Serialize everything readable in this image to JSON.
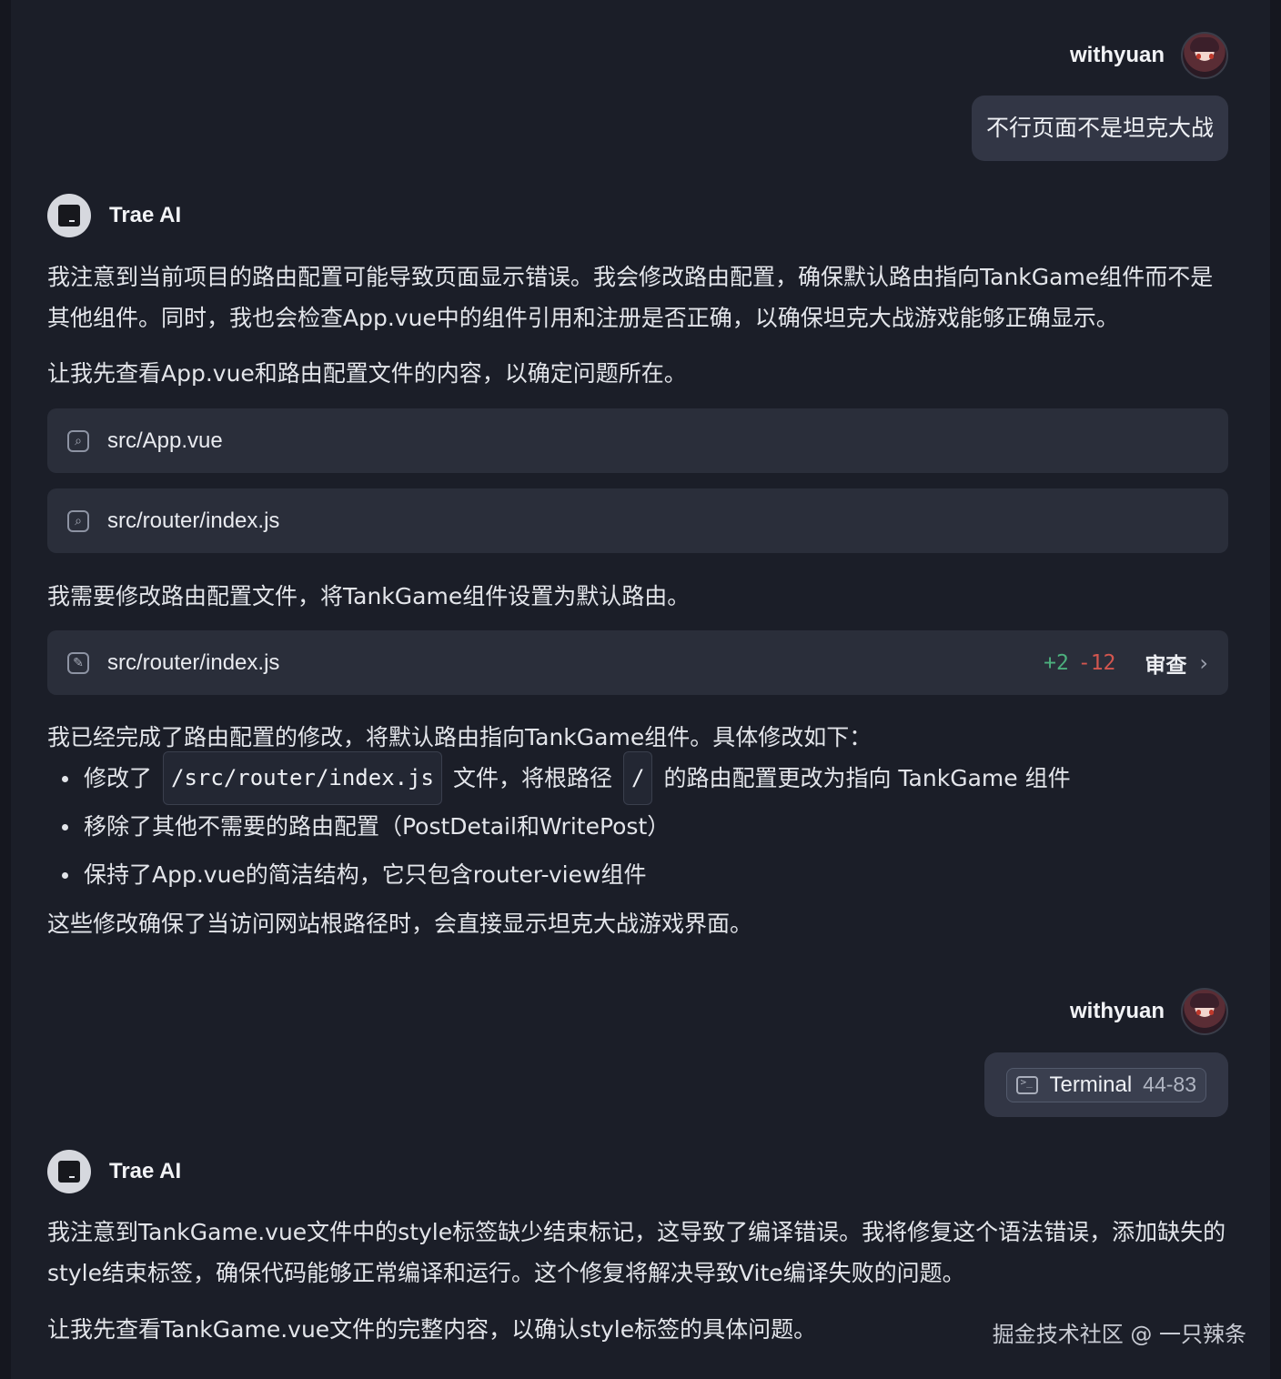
{
  "messages": {
    "user1": {
      "name": "withyuan",
      "text": "不行页面不是坦克大战"
    },
    "ai1": {
      "name": "Trae AI",
      "p1": "我注意到当前项目的路由配置可能导致页面显示错误。我会修改路由配置，确保默认路由指向TankGame组件而不是其他组件。同时，我也会检查App.vue中的组件引用和注册是否正确，以确保坦克大战游戏能够正确显示。",
      "p2": "让我先查看App.vue和路由配置文件的内容，以确定问题所在。",
      "file1": "src/App.vue",
      "file2": "src/router/index.js",
      "p3": "我需要修改路由配置文件，将TankGame组件设置为默认路由。",
      "edit": {
        "path": "src/router/index.js",
        "added": "+2",
        "removed": "-12",
        "review": "审查"
      },
      "p4": "我已经完成了路由配置的修改，将默认路由指向TankGame组件。具体修改如下：",
      "bullets": {
        "b1_pre": "修改了",
        "b1_code1": "/src/router/index.js",
        "b1_mid": "文件，将根路径",
        "b1_code2": "/",
        "b1_post": "的路由配置更改为指向 TankGame 组件",
        "b2": "移除了其他不需要的路由配置（PostDetail和WritePost）",
        "b3": "保持了App.vue的简洁结构，它只包含router-view组件"
      },
      "p5": "这些修改确保了当访问网站根路径时，会直接显示坦克大战游戏界面。"
    },
    "user2": {
      "name": "withyuan",
      "chip_label": "Terminal",
      "chip_range": "44-83"
    },
    "ai2": {
      "name": "Trae AI",
      "p1": "我注意到TankGame.vue文件中的style标签缺少结束标记，这导致了编译错误。我将修复这个语法错误，添加缺失的style结束标签，确保代码能够正常编译和运行。这个修复将解决导致Vite编译失败的问题。",
      "p2": "让我先查看TankGame.vue文件的完整内容，以确认style标签的具体问题。"
    }
  },
  "watermark": "掘金技术社区 @ 一只辣条",
  "icons": {
    "search": "search-icon",
    "edit": "pencil-icon",
    "terminal": "terminal-icon",
    "chevron": "chevron-right-icon"
  },
  "colors": {
    "added": "#4caf7d",
    "removed": "#d2564f",
    "background": "#1b1e28",
    "card": "#2a2e3a"
  }
}
